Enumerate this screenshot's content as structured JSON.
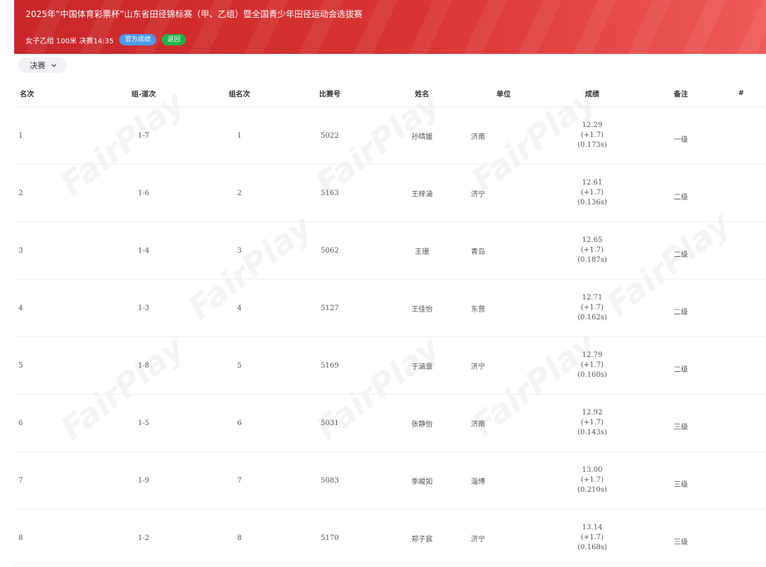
{
  "header": {
    "title": "2025年“中国体育彩票杯”山东省田径锦标赛（甲、乙组）暨全国青少年田径运动会选拔赛",
    "event_info": "女子乙组 100米 决赛14:35",
    "official_badge": "官方成绩",
    "back_button": "返回"
  },
  "round_select": {
    "value": "决赛"
  },
  "watermark": "FairPlay",
  "table": {
    "columns": [
      "名次",
      "组-道次",
      "组名次",
      "比赛号",
      "姓名",
      "单位",
      "成绩",
      "备注",
      "#"
    ],
    "rows": [
      {
        "rank": "1",
        "heat_lane": "1-7",
        "heat_rank": "1",
        "bib": "5022",
        "name": "孙晴媛",
        "unit": "济南",
        "time": "12.29",
        "wind": "(+1.7)",
        "reaction": "(0.173s)",
        "note": "一级"
      },
      {
        "rank": "2",
        "heat_lane": "1-6",
        "heat_rank": "2",
        "bib": "5163",
        "name": "王梓涵",
        "unit": "济宁",
        "time": "12.61",
        "wind": "(+1.7)",
        "reaction": "(0.136s)",
        "note": "二级"
      },
      {
        "rank": "3",
        "heat_lane": "1-4",
        "heat_rank": "3",
        "bib": "5062",
        "name": "王珊",
        "unit": "青岛",
        "time": "12.65",
        "wind": "(+1.7)",
        "reaction": "(0.187s)",
        "note": "二级"
      },
      {
        "rank": "4",
        "heat_lane": "1-3",
        "heat_rank": "4",
        "bib": "5127",
        "name": "王佳怡",
        "unit": "东营",
        "time": "12.71",
        "wind": "(+1.7)",
        "reaction": "(0.162s)",
        "note": "二级"
      },
      {
        "rank": "5",
        "heat_lane": "1-8",
        "heat_rank": "5",
        "bib": "5169",
        "name": "于涵霏",
        "unit": "济宁",
        "time": "12.79",
        "wind": "(+1.7)",
        "reaction": "(0.160s)",
        "note": "二级"
      },
      {
        "rank": "6",
        "heat_lane": "1-5",
        "heat_rank": "6",
        "bib": "5031",
        "name": "张静怡",
        "unit": "济南",
        "time": "12.92",
        "wind": "(+1.7)",
        "reaction": "(0.143s)",
        "note": "三级"
      },
      {
        "rank": "7",
        "heat_lane": "1-9",
        "heat_rank": "7",
        "bib": "5083",
        "name": "季峻如",
        "unit": "淄博",
        "time": "13.00",
        "wind": "(+1.7)",
        "reaction": "(0.210s)",
        "note": "三级"
      },
      {
        "rank": "8",
        "heat_lane": "1-2",
        "heat_rank": "8",
        "bib": "5170",
        "name": "郑子宸",
        "unit": "济宁",
        "time": "13.14",
        "wind": "(+1.7)",
        "reaction": "(0.168s)",
        "note": "三级"
      }
    ]
  }
}
